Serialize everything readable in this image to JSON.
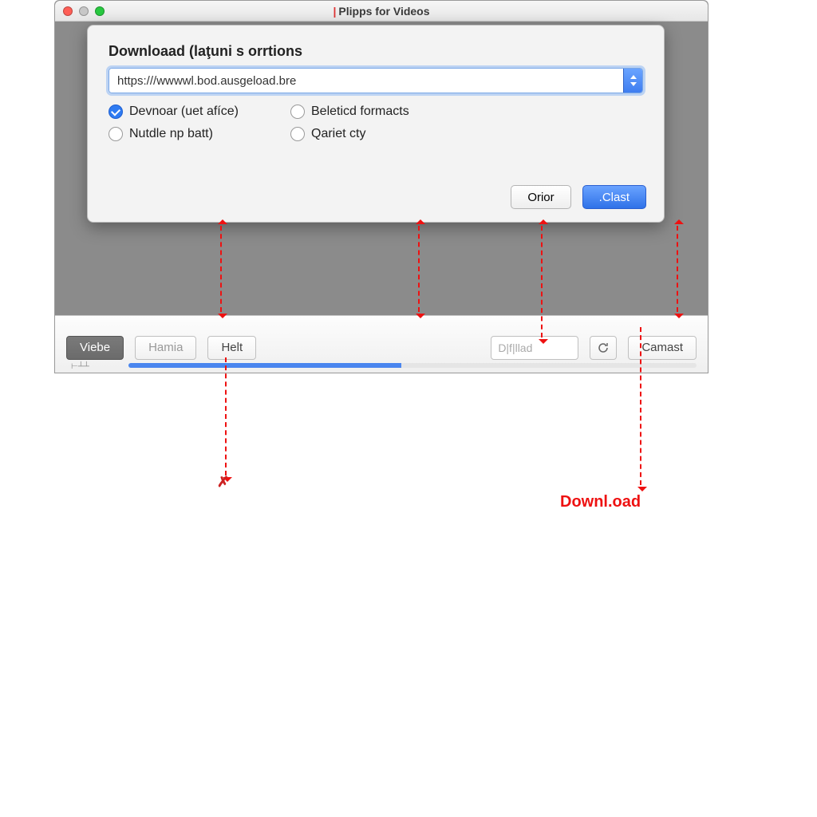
{
  "window": {
    "title": "Plipps for Videos"
  },
  "sheet": {
    "heading": "Downloaad (laţuni s orrtions",
    "url": "https:///wwwwl.bod.ausgeload.bre",
    "options": [
      {
        "label": "Devnoar (uet afíce)",
        "checked": true
      },
      {
        "label": "Beleticd formacts",
        "checked": false
      },
      {
        "label": "Nutdle np batt)",
        "checked": false
      },
      {
        "label": "Qariet cty",
        "checked": false
      }
    ],
    "buttons": {
      "cancel": "Orior",
      "ok": ".Clast"
    }
  },
  "toolbar": {
    "btn1": "Viebe",
    "btn2": "Hamia",
    "btn3": "Helt",
    "search_placeholder": "D|f|llad",
    "btn_right": "Camast"
  },
  "progress_percent": 48,
  "annotations": {
    "download_label": "Downl.oad"
  }
}
